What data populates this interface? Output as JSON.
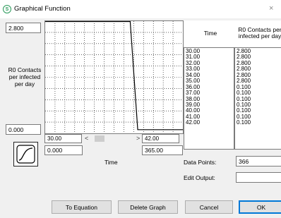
{
  "window": {
    "title": "Graphical Function",
    "app_icon": "S",
    "close_glyph": "×"
  },
  "graph": {
    "y_max": "2.800",
    "y_min": "0.000",
    "y_label": "R0 Contacts\nper infected\nper day",
    "x_axis_label": "Time",
    "x_min": "0.000",
    "x_max": "365.00",
    "view_start": "30.00",
    "view_end": "42.00",
    "line_color": "#000000"
  },
  "table": {
    "time_header": "Time",
    "value_header_line1": "R0 Contacts  per",
    "value_header_line2": "infected per day",
    "times": [
      "30.00",
      "31.00",
      "32.00",
      "33.00",
      "34.00",
      "35.00",
      "36.00",
      "37.00",
      "38.00",
      "39.00",
      "40.00",
      "41.00",
      "42.00"
    ],
    "values": [
      "2.800",
      "2.800",
      "2.800",
      "2.800",
      "2.800",
      "2.800",
      "0.100",
      "0.100",
      "0.100",
      "0.100",
      "0.100",
      "0.100",
      "0.100"
    ]
  },
  "data_points": {
    "label": "Data Points:",
    "value": "366"
  },
  "edit_output": {
    "label": "Edit Output:",
    "value": ""
  },
  "buttons": {
    "to_equation": "To Equation",
    "delete_graph": "Delete Graph",
    "cancel": "Cancel",
    "ok": "OK"
  },
  "scroll": {
    "left_glyph": "<",
    "right_glyph": ">"
  }
}
